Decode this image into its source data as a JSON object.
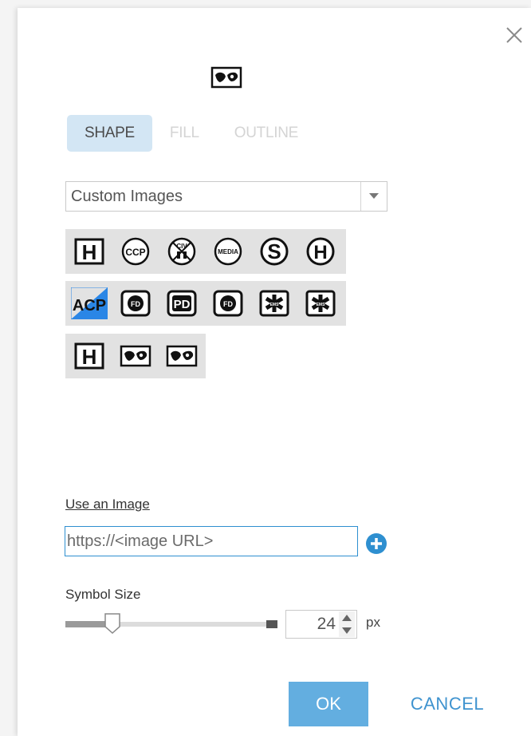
{
  "tabs": [
    {
      "label": "SHAPE",
      "active": true
    },
    {
      "label": "FILL",
      "active": false
    },
    {
      "label": "OUTLINE",
      "active": false
    }
  ],
  "symbol_set": {
    "selected": "Custom Images"
  },
  "symbols": {
    "row1": [
      {
        "name": "hospital-h",
        "text": "H"
      },
      {
        "name": "ccp",
        "text": "CCP"
      },
      {
        "name": "civ",
        "text": "CIV"
      },
      {
        "name": "media",
        "text": "MEDIA"
      },
      {
        "name": "s-circle",
        "text": "S"
      },
      {
        "name": "h-circle",
        "text": "H"
      }
    ],
    "row2": [
      {
        "name": "acp",
        "text": "ACP",
        "selected": true
      },
      {
        "name": "fd",
        "text": "FD"
      },
      {
        "name": "pd",
        "text": "PD"
      },
      {
        "name": "fd-2",
        "text": "FD"
      },
      {
        "name": "ems",
        "text": "EMS"
      },
      {
        "name": "ems-2",
        "text": "EMS"
      }
    ],
    "row3": [
      {
        "name": "hospital-h-2",
        "text": "H"
      },
      {
        "name": "mask"
      },
      {
        "name": "mask-2"
      }
    ]
  },
  "use_image": {
    "label": "Use an Image",
    "placeholder": "https://<image URL>"
  },
  "symbol_size": {
    "label": "Symbol Size",
    "value": "24",
    "unit": "px",
    "slider_fraction": 0.22
  },
  "buttons": {
    "ok": "OK",
    "cancel": "CANCEL"
  },
  "colors": {
    "accent": "#63aee0",
    "link": "#3f93cf",
    "tab_active_bg": "#d3e6f4"
  }
}
